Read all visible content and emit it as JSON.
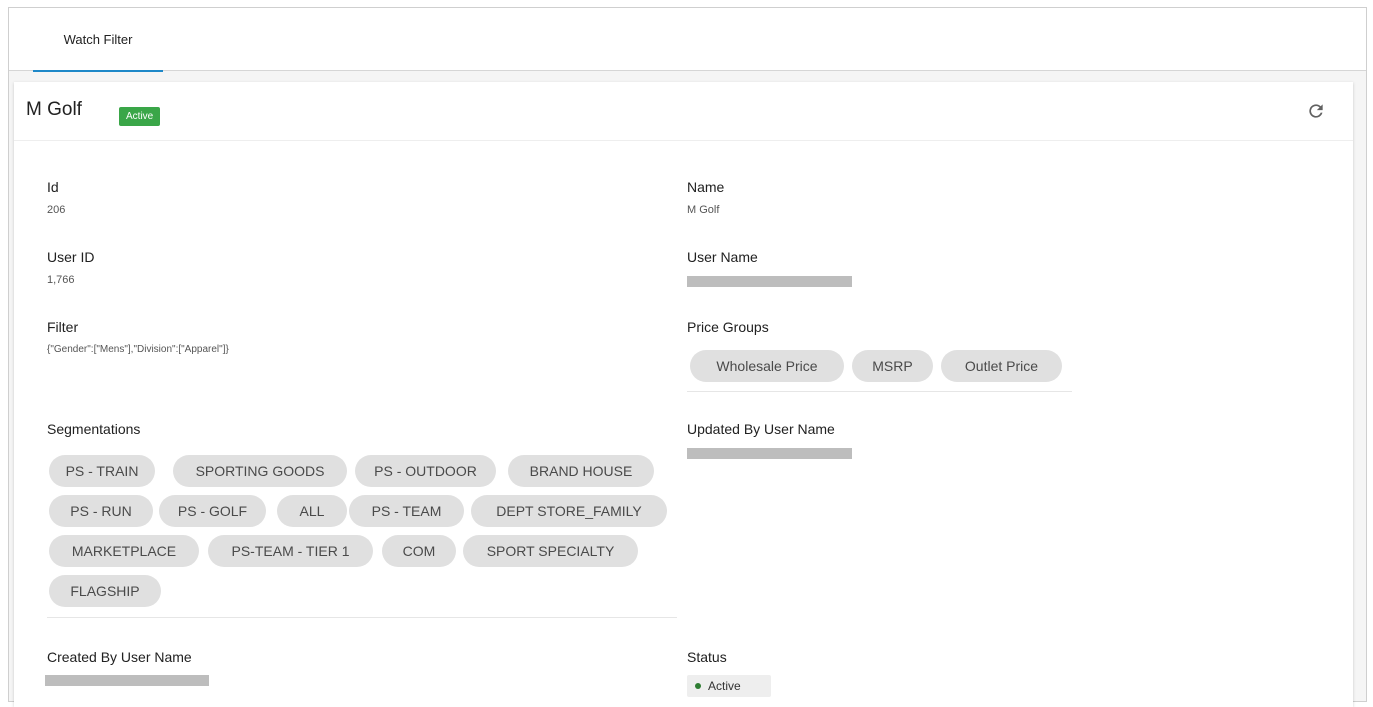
{
  "tabs": [
    {
      "label": "Watch Filter",
      "active": true
    }
  ],
  "header": {
    "title": "M Golf",
    "badge": "Active",
    "refresh_icon": "refresh-icon"
  },
  "fields": {
    "id": {
      "label": "Id",
      "value": "206"
    },
    "name": {
      "label": "Name",
      "value": "M Golf"
    },
    "user_id": {
      "label": "User ID",
      "value": "1,766"
    },
    "user_name": {
      "label": "User Name"
    },
    "filter": {
      "label": "Filter",
      "value": "{\"Gender\":[\"Mens\"],\"Division\":[\"Apparel\"]}"
    },
    "price_groups": {
      "label": "Price Groups",
      "items": [
        "Wholesale Price",
        "MSRP",
        "Outlet Price"
      ]
    },
    "segmentations": {
      "label": "Segmentations",
      "items": [
        "PS - TRAIN",
        "SPORTING GOODS",
        "PS - OUTDOOR",
        "BRAND HOUSE",
        "PS - RUN",
        "PS - GOLF",
        "ALL",
        "PS - TEAM",
        "DEPT STORE_FAMILY",
        "MARKETPLACE",
        "PS-TEAM - TIER 1",
        "COM",
        "SPORT SPECIALTY",
        "FLAGSHIP"
      ]
    },
    "updated_by": {
      "label": "Updated By User Name"
    },
    "created_by": {
      "label": "Created By User Name"
    },
    "status": {
      "label": "Status",
      "value": "Active"
    }
  },
  "colors": {
    "badge_green": "#3aa648",
    "tab_accent": "#1e88c8",
    "status_dot": "#2e7d32",
    "chip_bg": "#e0e0e0"
  }
}
